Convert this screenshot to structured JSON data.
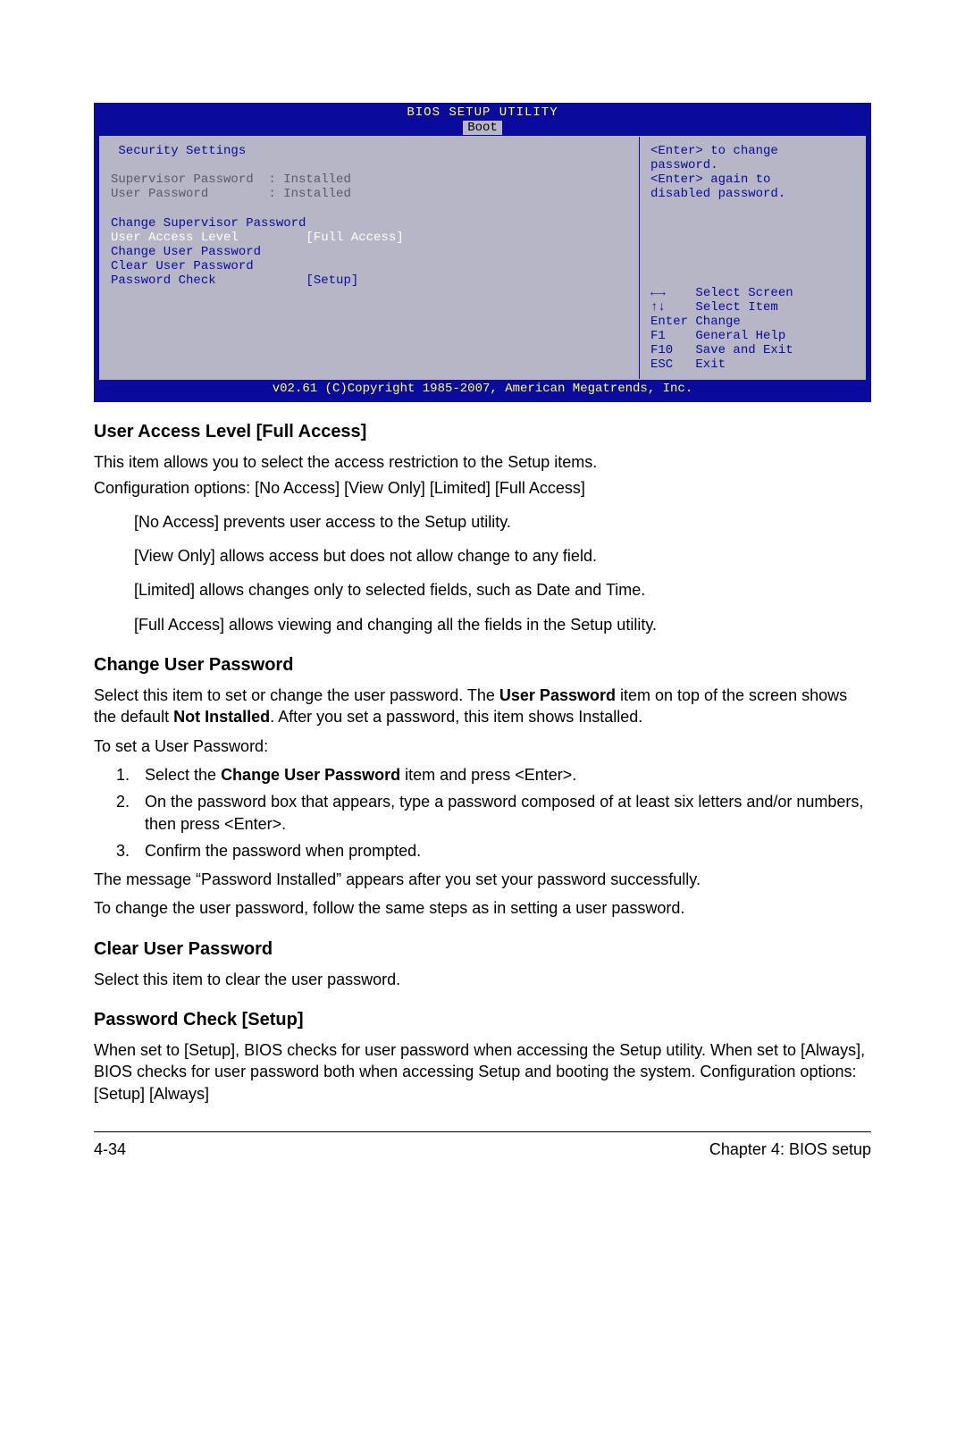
{
  "bios": {
    "title": "BIOS SETUP UTILITY",
    "tab": "Boot",
    "section_title": " Security Settings",
    "supervisor_row": "Supervisor Password  : Installed",
    "user_row": "User Password        : Installed",
    "items": {
      "change_sup": "Change Supervisor Password",
      "ual_row": "User Access Level         [Full Access]",
      "change_user": "Change User Password",
      "clear_user": "Clear User Password",
      "pwd_check": "Password Check            [Setup]"
    },
    "help": {
      "l1": "<Enter> to change",
      "l2": "password.",
      "l3": "<Enter> again to",
      "l4": "disabled password."
    },
    "nav": {
      "lr": "    Select Screen",
      "ud": "    Select Item",
      "enter": "Enter Change",
      "f1": "F1    General Help",
      "f10": "F10   Save and Exit",
      "esc": "ESC   Exit"
    },
    "footer": "v02.61 (C)Copyright 1985-2007, American Megatrends, Inc."
  },
  "doc": {
    "h1": "User Access Level [Full Access]",
    "p1a": "This item allows you to select the access restriction to the Setup items.",
    "p1b": "Configuration options: [No Access] [View Only] [Limited] [Full Access]",
    "opt1": "[No Access] prevents user access to the Setup utility.",
    "opt2": "[View Only] allows access but does not allow change to any field.",
    "opt3": "[Limited] allows changes only to selected fields, such as Date and Time.",
    "opt4": "[Full Access] allows viewing and changing all the fields in the Setup utility.",
    "h2": "Change User Password",
    "p2a": "Select this item to set or change the user password. The ",
    "p2b": "User Password",
    "p2c": " item on top of the screen shows the default ",
    "p2d": "Not Installed",
    "p2e": ". After you set a password, this item shows Installed.",
    "p3": "To set a User Password:",
    "li1a": "Select the ",
    "li1b": "Change User Password",
    "li1c": " item and press <Enter>.",
    "li2": "On the password box that appears, type a password composed of at least six letters and/or numbers, then press <Enter>.",
    "li3": "Confirm the password when prompted.",
    "p4": "The message “Password Installed” appears after you set your password successfully.",
    "p5": "To change the user password, follow the same steps as in setting a user password.",
    "h3": "Clear User Password",
    "p6": "Select this item to clear the user password.",
    "h4": "Password Check [Setup]",
    "p7": "When set to [Setup], BIOS checks for user password when accessing the Setup utility. When set to [Always], BIOS checks for user password both when accessing Setup and booting the system. Configuration options: [Setup] [Always]"
  },
  "footer": {
    "page": "4-34",
    "chapter": "Chapter 4: BIOS setup"
  }
}
